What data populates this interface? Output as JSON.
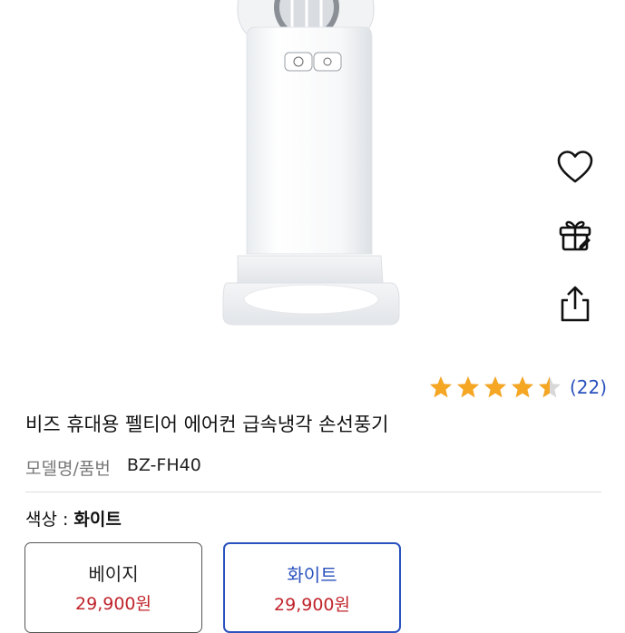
{
  "product": {
    "title": "비즈 휴대용 펠티어 에어컨 급속냉각 손선풍기",
    "rating": 4.5,
    "max_rating": 5,
    "review_count": "(22)",
    "model_label": "모델명/품번",
    "model_value": "BZ-FH40"
  },
  "color_selection": {
    "label": "색상",
    "separator": ":",
    "selected": "화이트"
  },
  "options": [
    {
      "name": "베이지",
      "price": "29,900원",
      "selected": false
    },
    {
      "name": "화이트",
      "price": "29,900원",
      "selected": true
    }
  ],
  "side_actions": [
    {
      "icon": "heart-icon"
    },
    {
      "icon": "gift-icon"
    },
    {
      "icon": "share-icon"
    }
  ],
  "colors": {
    "accent": "#2a52be",
    "price": "#c0242b",
    "star": "#f5a623",
    "star_empty": "#d8d8d8"
  }
}
